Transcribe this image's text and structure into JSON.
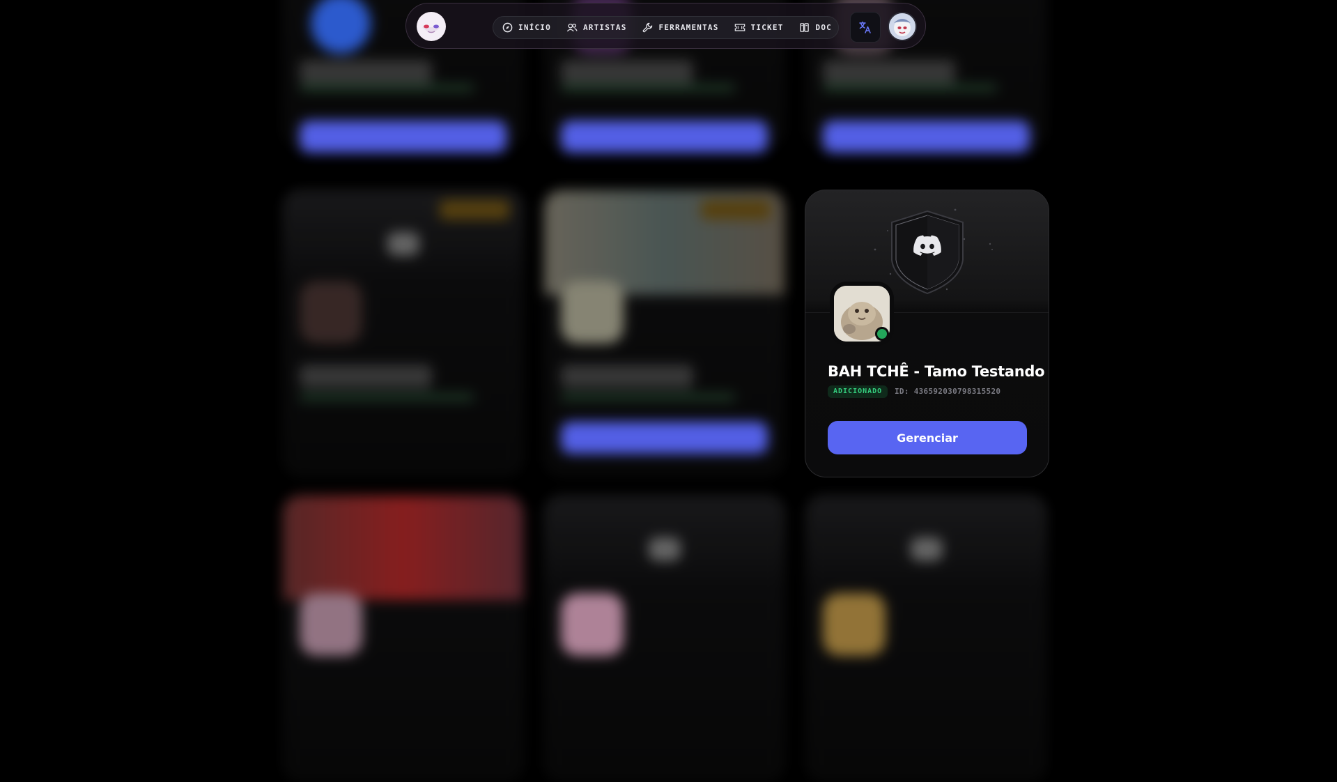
{
  "nav": {
    "links": [
      {
        "label": "INÍCIO",
        "icon": "compass-icon"
      },
      {
        "label": "ARTISTAS",
        "icon": "users-icon"
      },
      {
        "label": "FERRAMENTAS",
        "icon": "wrench-icon"
      },
      {
        "label": "TICKET",
        "icon": "ticket-icon"
      },
      {
        "label": "DOC",
        "icon": "book-icon"
      }
    ],
    "translate_icon": "translate-icon"
  },
  "server_card": {
    "name": "BAH TCHÊ - Tamo Testando",
    "status": "ADICIONADO",
    "id_text": "ID: 436592030798315520",
    "manage_label": "Gerenciar",
    "online": true
  },
  "colors": {
    "accent": "#5865f2",
    "online": "#23a55a",
    "badge_text": "#35d07f",
    "background": "#000000"
  }
}
